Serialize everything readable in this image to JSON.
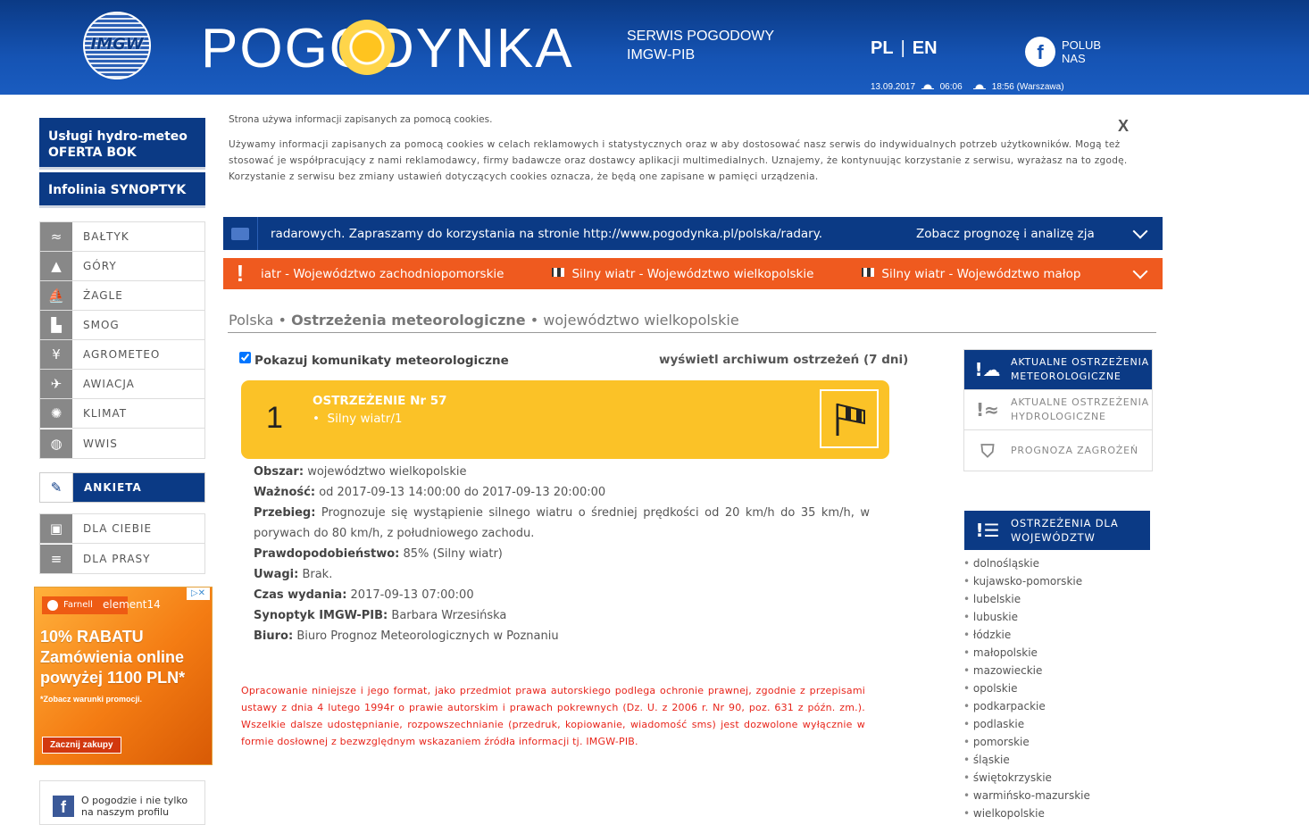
{
  "header": {
    "logo_text": "POGODYNKA",
    "imgw_logo_text": "IMGW",
    "tagline_line1": "SERWIS POGODOWY",
    "tagline_line2": "IMGW-PIB",
    "lang_pl": "PL",
    "lang_sep": "|",
    "lang_en": "EN",
    "fb_letter": "f",
    "fb_line1": "POLUB",
    "fb_line2": "NAS",
    "date": "13.09.2017",
    "sunrise": "06:06",
    "sunset": "18:56 (Warszawa)"
  },
  "sidebar": {
    "oferta_line1": "Usługi hydro-meteo",
    "oferta_line2": "OFERTA BOK",
    "synoptyk": "Infolinia SYNOPTYK",
    "menu": [
      {
        "label": "BAŁTYK",
        "icon": "waves-icon",
        "glyph": "≈"
      },
      {
        "label": "GÓRY",
        "icon": "mountains-icon",
        "glyph": "▲"
      },
      {
        "label": "ŻAGLE",
        "icon": "sail-icon",
        "glyph": "⛵"
      },
      {
        "label": "SMOG",
        "icon": "factory-icon",
        "glyph": "▙"
      },
      {
        "label": "AGROMETEO",
        "icon": "wheat-icon",
        "glyph": "¥"
      },
      {
        "label": "AWIACJA",
        "icon": "airplane-icon",
        "glyph": "✈"
      },
      {
        "label": "KLIMAT",
        "icon": "sun-icon",
        "glyph": "✺"
      },
      {
        "label": "WWIS",
        "icon": "globe-icon",
        "glyph": "◍"
      }
    ],
    "ankieta": "ANKIETA",
    "ankieta_glyph": "✎",
    "menu2": [
      {
        "label": "DLA CIEBIE",
        "icon": "gift-icon",
        "glyph": "▣"
      },
      {
        "label": "DLA PRASY",
        "icon": "press-icon",
        "glyph": "≡"
      }
    ],
    "fb_box_letter": "f",
    "fb_box_line1": "O pogodzie i nie tylko",
    "fb_box_line2": "na naszym profilu"
  },
  "ad": {
    "badge": "Farnell",
    "brand": "element14",
    "close": "▷✕",
    "line1": "10% RABATU",
    "line2": "Zamówienia online",
    "line3": "powyżej 1100 PLN*",
    "note": "*Zobacz warunki promocji.",
    "cta": "Zacznij zakupy"
  },
  "cookie": {
    "title": "Strona używa informacji zapisanych za pomocą cookies.",
    "close": "X",
    "body": "Używamy informacji zapisanych za pomocą cookies w celach reklamowych i statystycznych oraz w aby dostosować nasz serwis do indywidualnych potrzeb użytkowników. Mogą też stosować je współpracujący z nami reklamodawcy, firmy badawcze oraz dostawcy aplikacji multimedialnych. Uznajemy, że kontynuując korzystanie z serwisu, wyrażasz na to zgodę. Korzystanie z serwisu bez zmiany ustawień dotyczących cookies oznacza, że będą one zapisane w pamięci urządzenia."
  },
  "bars": {
    "info_text": "radarowych. Zapraszamy do korzystania na stronie http://www.pogodynka.pl/polska/radary.",
    "info_right": "Zobacz prognozę i analizę zja",
    "warn_item1": "iatr - Województwo zachodniopomorskie",
    "warn_item2": "Silny wiatr - Województwo wielkopolskie",
    "warn_item3": "Silny wiatr - Województwo małop",
    "warn_glyph": "!"
  },
  "breadcrumb": {
    "root": "Polska",
    "sep": "•",
    "section": "Ostrzeżenia meteorologiczne",
    "current": "województwo wielkopolskie"
  },
  "warning": {
    "checkbox_label": "Pokazuj komunikaty meteorologiczne",
    "archive_link": "wyświetl archiwum ostrzeżeń (7 dni)",
    "level": "1",
    "title": "OSTRZEŻENIE Nr 57",
    "item": "Silny wiatr/1",
    "details": [
      {
        "label": "Obszar:",
        "value": "województwo wielkopolskie"
      },
      {
        "label": "Ważność:",
        "value": "od 2017-09-13 14:00:00 do 2017-09-13 20:00:00"
      },
      {
        "label": "Przebieg:",
        "value": "Prognozuje się wystąpienie silnego wiatru o średniej prędkości od 20 km/h do 35 km/h, w porywach do 80 km/h, z południowego zachodu."
      },
      {
        "label": "Prawdopodobieństwo:",
        "value": "85% (Silny wiatr)"
      },
      {
        "label": "Uwagi:",
        "value": "Brak."
      },
      {
        "label": "Czas wydania:",
        "value": "2017-09-13 07:00:00"
      },
      {
        "label": "Synoptyk IMGW-PIB:",
        "value": "Barbara Wrzesińska"
      },
      {
        "label": "Biuro:",
        "value": "Biuro Prognoz Meteorologicznych w Poznaniu"
      }
    ],
    "copyright": "Opracowanie niniejsze i jego format, jako przedmiot prawa autorskiego podlega ochronie prawnej, zgodnie z przepisami ustawy z dnia 4 lutego 1994r o prawie autorskim i prawach pokrewnych (Dz. U. z 2006 r. Nr 90, poz. 631 z późn. zm.). Wszelkie dalsze udostępnianie, rozpowszechnianie (przedruk, kopiowanie, wiadomość sms) jest dozwolone wyłącznie w formie dosłownej z bezwzględnym wskazaniem źródła informacji tj. IMGW-PIB."
  },
  "right": {
    "tabs": [
      {
        "line1": "AKTUALNE OSTRZEŻENIA",
        "line2": "METEOROLOGICZNE",
        "glyph": "!☁",
        "icon": "weather-warning-icon"
      },
      {
        "line1": "AKTUALNE OSTRZEŻENIA",
        "line2": "HYDROLOGICZNE",
        "glyph": "!≈",
        "icon": "hydro-warning-icon"
      },
      {
        "line1": "PROGNOZA ZAGROŻEŃ",
        "line2": "",
        "glyph": "⛉",
        "icon": "shield-warning-icon"
      }
    ],
    "voiv_line1": "OSTRZEŻENIA DLA",
    "voiv_line2": "WOJEWÓDZTW",
    "voiv_glyph": "!☰",
    "voivodeships": [
      "dolnośląskie",
      "kujawsko-pomorskie",
      "lubelskie",
      "lubuskie",
      "łódzkie",
      "małopolskie",
      "mazowieckie",
      "opolskie",
      "podkarpackie",
      "podlaskie",
      "pomorskie",
      "śląskie",
      "świętokrzyskie",
      "warmińsko-mazurskie",
      "wielkopolskie"
    ]
  },
  "colors": {
    "brand_blue": "#0b3a85",
    "warning_orange": "#ef5a1f",
    "warning_yellow": "#fbc227",
    "copyright_red": "#e8251b"
  }
}
